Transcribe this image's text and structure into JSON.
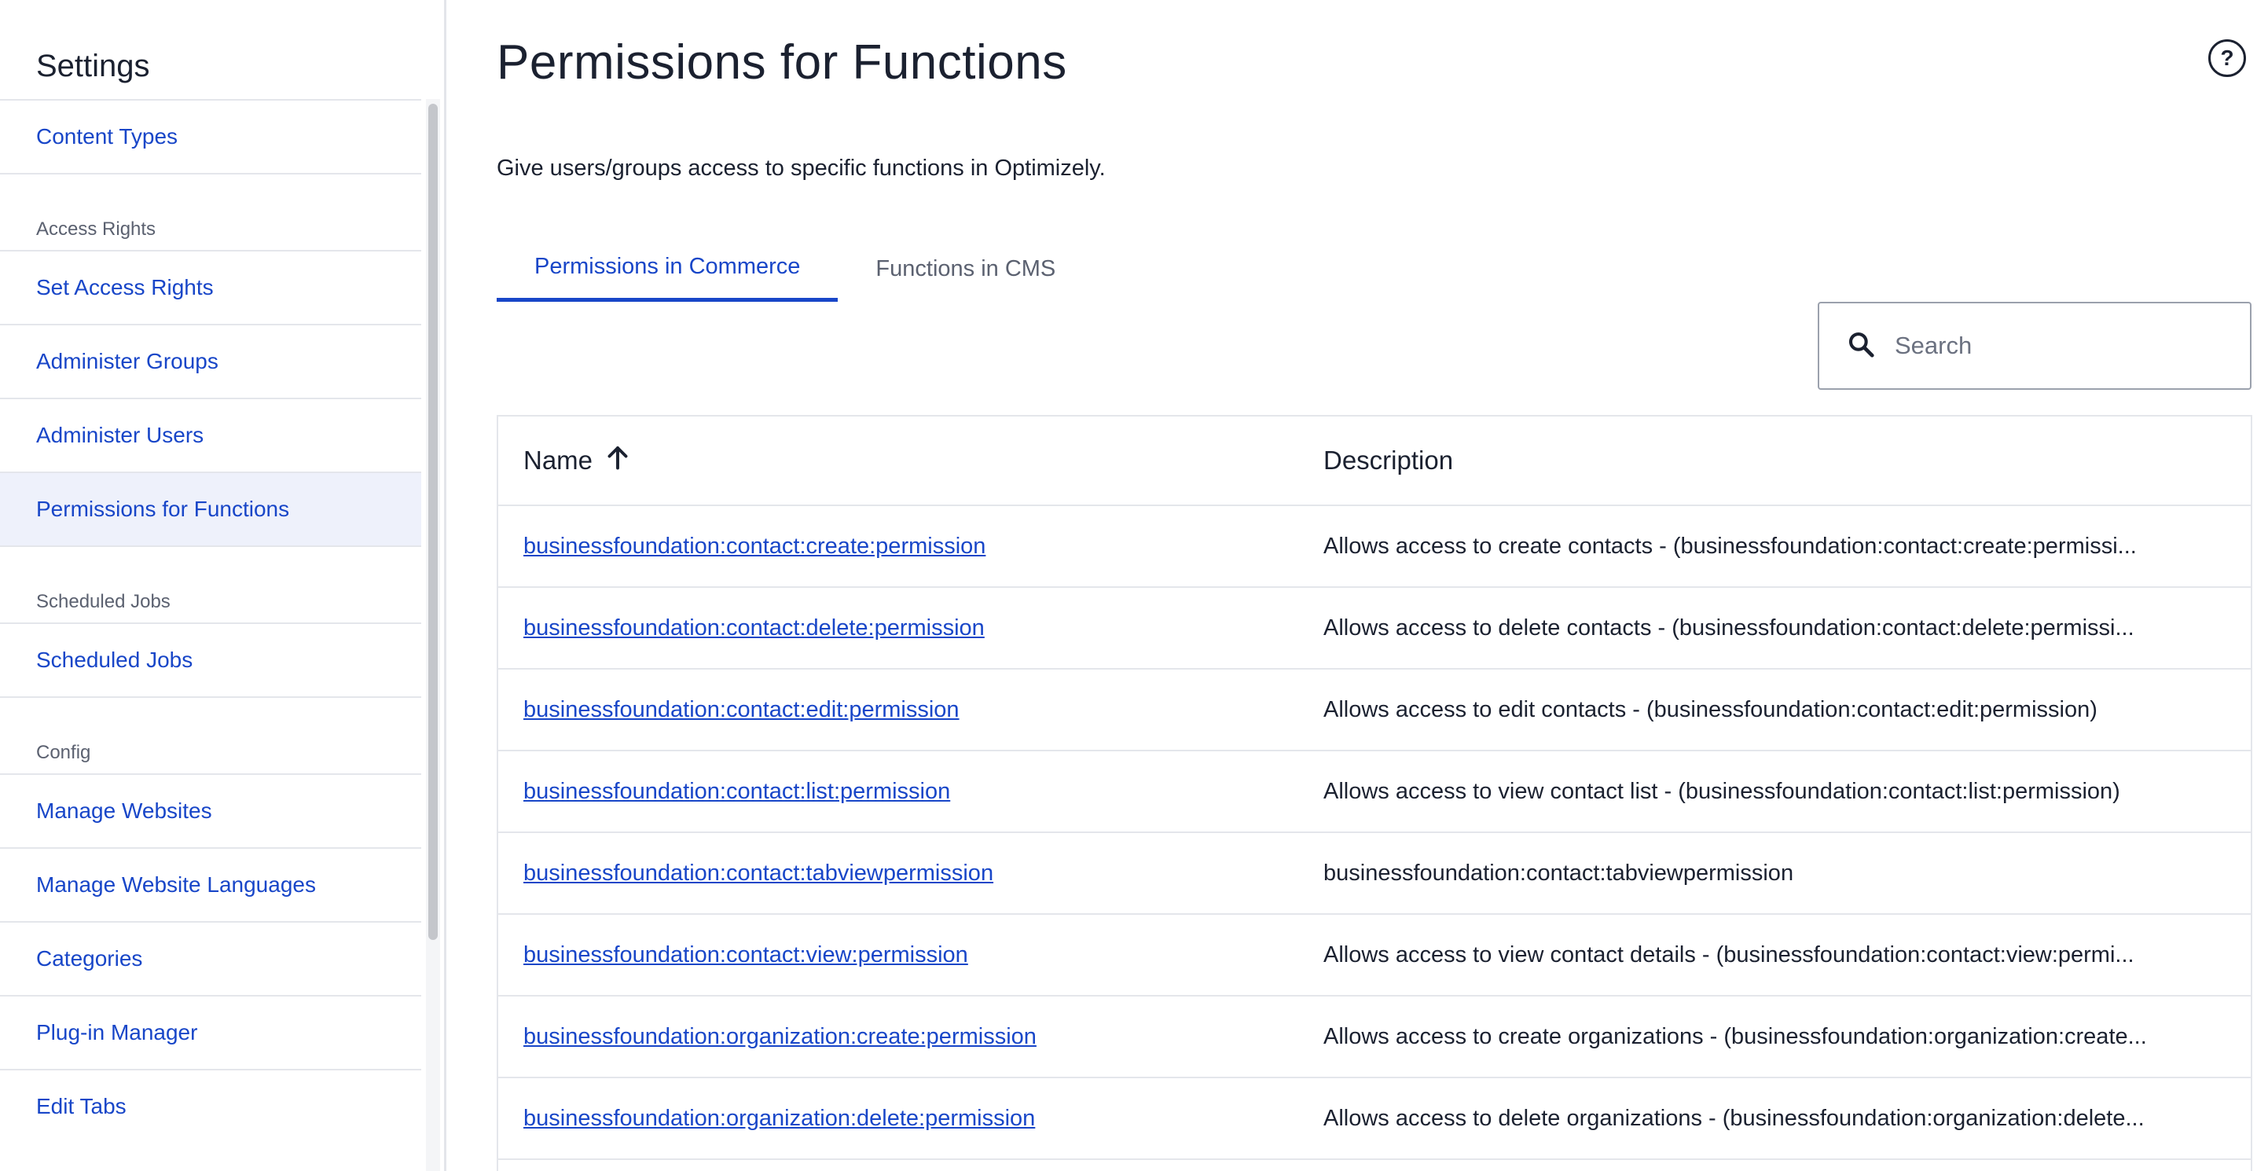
{
  "sidebar": {
    "title": "Settings",
    "items": [
      {
        "type": "item",
        "label": "Content Types",
        "name": "sidebar-item-content-types"
      },
      {
        "type": "section",
        "label": "Access Rights",
        "name": "sidebar-section-access-rights"
      },
      {
        "type": "item",
        "label": "Set Access Rights",
        "name": "sidebar-item-set-access-rights"
      },
      {
        "type": "item",
        "label": "Administer Groups",
        "name": "sidebar-item-administer-groups"
      },
      {
        "type": "item",
        "label": "Administer Users",
        "name": "sidebar-item-administer-users"
      },
      {
        "type": "item",
        "label": "Permissions for Functions",
        "name": "sidebar-item-permissions-for-functions",
        "active": true
      },
      {
        "type": "section",
        "label": "Scheduled Jobs",
        "name": "sidebar-section-scheduled-jobs"
      },
      {
        "type": "item",
        "label": "Scheduled Jobs",
        "name": "sidebar-item-scheduled-jobs"
      },
      {
        "type": "section",
        "label": "Config",
        "name": "sidebar-section-config"
      },
      {
        "type": "item",
        "label": "Manage Websites",
        "name": "sidebar-item-manage-websites"
      },
      {
        "type": "item",
        "label": "Manage Website Languages",
        "name": "sidebar-item-manage-website-languages"
      },
      {
        "type": "item",
        "label": "Categories",
        "name": "sidebar-item-categories"
      },
      {
        "type": "item",
        "label": "Plug-in Manager",
        "name": "sidebar-item-plug-in-manager"
      },
      {
        "type": "item",
        "label": "Edit Tabs",
        "name": "sidebar-item-edit-tabs"
      }
    ]
  },
  "main": {
    "title": "Permissions for Functions",
    "help_icon": "?",
    "subtitle": "Give users/groups access to specific functions in Optimizely.",
    "tabs": [
      {
        "label": "Permissions in Commerce",
        "active": true
      },
      {
        "label": "Functions in CMS",
        "active": false
      }
    ],
    "search": {
      "placeholder": "Search",
      "icon": "search-icon"
    },
    "table": {
      "columns": {
        "name": "Name",
        "description": "Description",
        "sort": "ascending"
      },
      "rows": [
        {
          "name": "businessfoundation:contact:create:permission",
          "description": "Allows access to create contacts - (businessfoundation:contact:create:permissi..."
        },
        {
          "name": "businessfoundation:contact:delete:permission",
          "description": "Allows access to delete contacts - (businessfoundation:contact:delete:permissi..."
        },
        {
          "name": "businessfoundation:contact:edit:permission",
          "description": "Allows access to edit contacts - (businessfoundation:contact:edit:permission)"
        },
        {
          "name": "businessfoundation:contact:list:permission",
          "description": "Allows access to view contact list - (businessfoundation:contact:list:permission)"
        },
        {
          "name": "businessfoundation:contact:tabviewpermission",
          "description": "businessfoundation:contact:tabviewpermission"
        },
        {
          "name": "businessfoundation:contact:view:permission",
          "description": "Allows access to view contact details - (businessfoundation:contact:view:permi..."
        },
        {
          "name": "businessfoundation:organization:create:permission",
          "description": "Allows access to create organizations - (businessfoundation:organization:create..."
        },
        {
          "name": "businessfoundation:organization:delete:permission",
          "description": "Allows access to delete organizations - (businessfoundation:organization:delete..."
        }
      ]
    }
  },
  "colors": {
    "accent": "#1846c8",
    "text": "#1b2130",
    "muted": "#5b6170",
    "border": "#e4e6eb",
    "active_bg": "#eef1fb"
  }
}
